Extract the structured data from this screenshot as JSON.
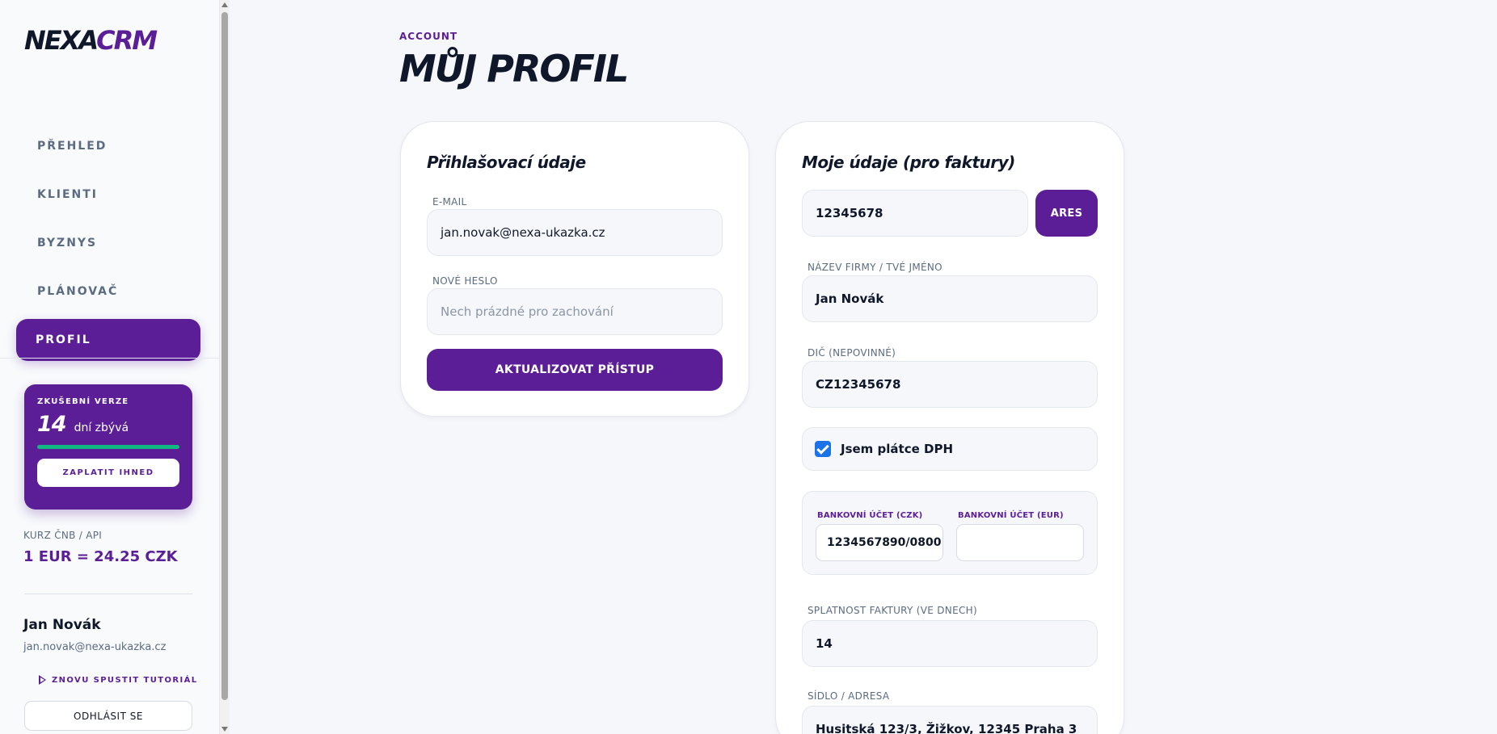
{
  "app": {
    "logo_part1": "NEXA",
    "logo_part2": "CRM"
  },
  "sidebar": {
    "items": [
      {
        "label": "PŘEHLED",
        "active": false
      },
      {
        "label": "KLIENTI",
        "active": false
      },
      {
        "label": "BYZNYS",
        "active": false
      },
      {
        "label": "PLÁNOVAČ",
        "active": false
      },
      {
        "label": "PROFIL",
        "active": true
      }
    ],
    "trial": {
      "label": "ZKUŠEBNÍ VERZE",
      "days": "14",
      "days_text": "dní zbývá",
      "progress_fraction": 1.0,
      "pay_button": "ZAPLATIT IHNED"
    },
    "rate": {
      "label": "KURZ ČNB / API",
      "value": "1 EUR = 24.25 CZK"
    },
    "user": {
      "name": "Jan Novák",
      "email": "jan.novak@nexa-ukazka.cz"
    },
    "tutorial_label": "ZNOVU SPUSTIT TUTORIÁL",
    "logout_label": "ODHLÁSIT SE"
  },
  "page": {
    "eyebrow": "ACCOUNT",
    "title": "MŮJ PROFIL"
  },
  "login_card": {
    "title": "Přihlašovací údaje",
    "email_label": "E-MAIL",
    "email_value": "jan.novak@nexa-ukazka.cz",
    "password_label": "NOVÉ HESLO",
    "password_placeholder": "Nech prázdné pro zachování",
    "submit_label": "AKTUALIZOVAT PŘÍSTUP"
  },
  "billing_card": {
    "title": "Moje údaje (pro faktury)",
    "ico_value": "12345678",
    "ares_button": "ARES",
    "company_label": "NÁZEV FIRMY / TVÉ JMÉNO",
    "company_value": "Jan Novák",
    "dic_label": "DIČ (NEPOVINNÉ)",
    "dic_value": "CZ12345678",
    "vat_payer_label": "Jsem plátce DPH",
    "vat_payer_checked": true,
    "bank_czk_label": "BANKOVNÍ ÚČET (CZK)",
    "bank_czk_value": "1234567890/0800",
    "bank_eur_label": "BANKOVNÍ ÚČET (EUR)",
    "bank_eur_value": "",
    "due_label": "SPLATNOST FAKTURY (VE DNECH)",
    "due_value": "14",
    "address_label": "SÍDLO / ADRESA",
    "address_value": "Husitská 123/3, Žižkov, 12345 Praha 3"
  },
  "colors": {
    "accent": "#5b1e97",
    "text": "#0f172a",
    "muted": "#5b6b82",
    "progress": "#10b981",
    "background": "#f6f7fb",
    "checkbox": "#1a73e8"
  }
}
